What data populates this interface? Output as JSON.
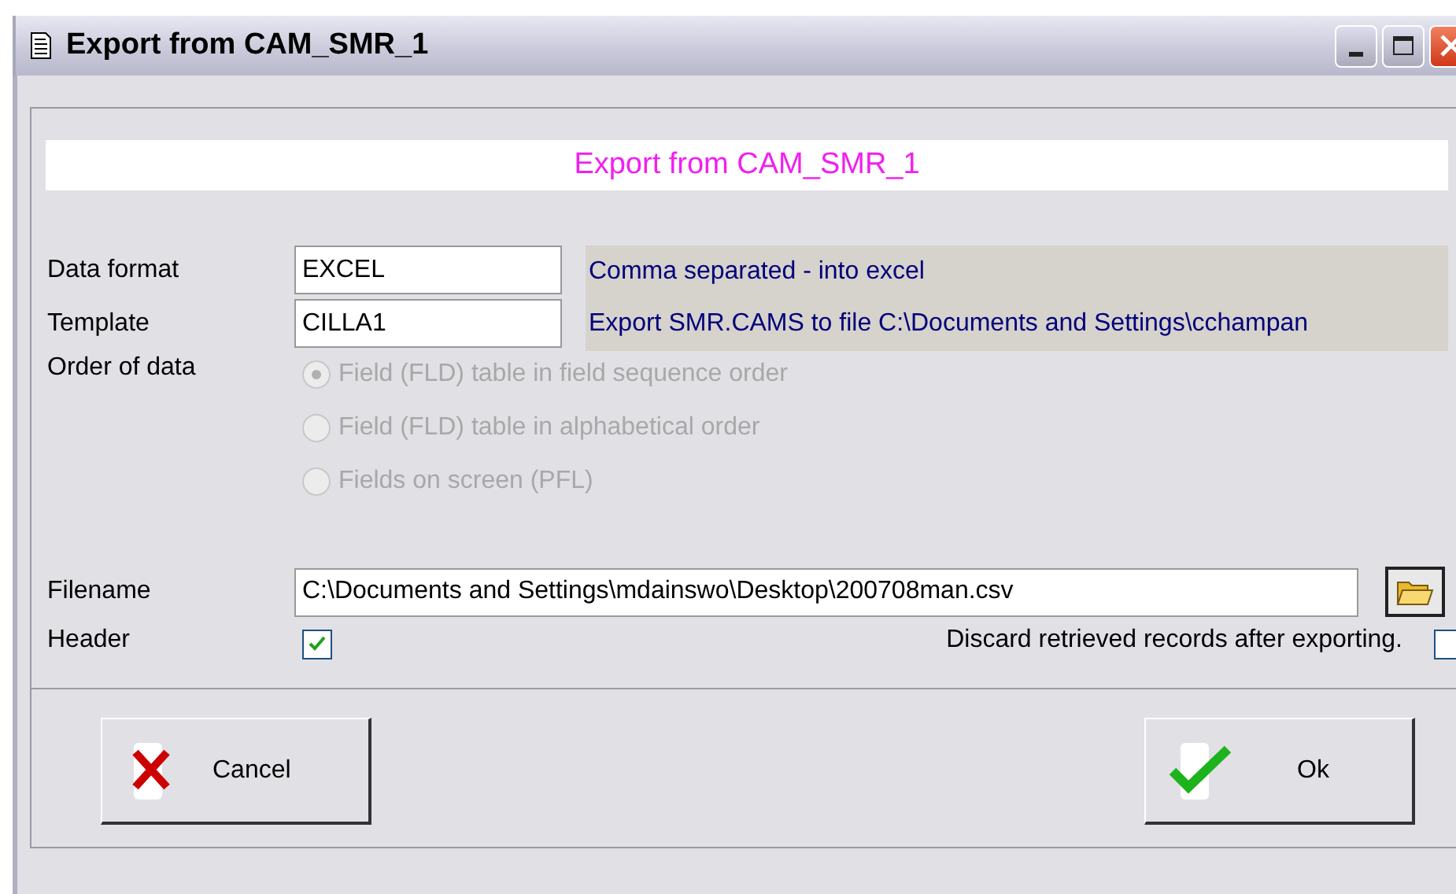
{
  "window": {
    "title": "Export from CAM_SMR_1"
  },
  "heading": "Export from CAM_SMR_1",
  "fields": [
    {
      "label": "Data format",
      "value": "EXCEL",
      "description": "Comma separated - into excel"
    },
    {
      "label": "Template",
      "value": "CILLA1",
      "description": "Export SMR.CAMS to file C:\\Documents and Settings\\cchampan"
    }
  ],
  "order_of_data": {
    "label": "Order of data",
    "disabled": true,
    "options": [
      {
        "label": "Field (FLD) table in field sequence order",
        "selected": true
      },
      {
        "label": "Field (FLD) table in alphabetical order",
        "selected": false
      },
      {
        "label": "Fields on screen (PFL)",
        "selected": false
      }
    ]
  },
  "filename": {
    "label": "Filename",
    "value": "C:\\Documents and Settings\\mdainswo\\Desktop\\200708man.csv"
  },
  "header": {
    "label": "Header",
    "checked": true
  },
  "discard": {
    "label": "Discard retrieved records after exporting.",
    "checked": false
  },
  "buttons": [
    {
      "kind": "cancel",
      "label": "Cancel"
    },
    {
      "kind": "ok",
      "label": "Ok"
    }
  ]
}
